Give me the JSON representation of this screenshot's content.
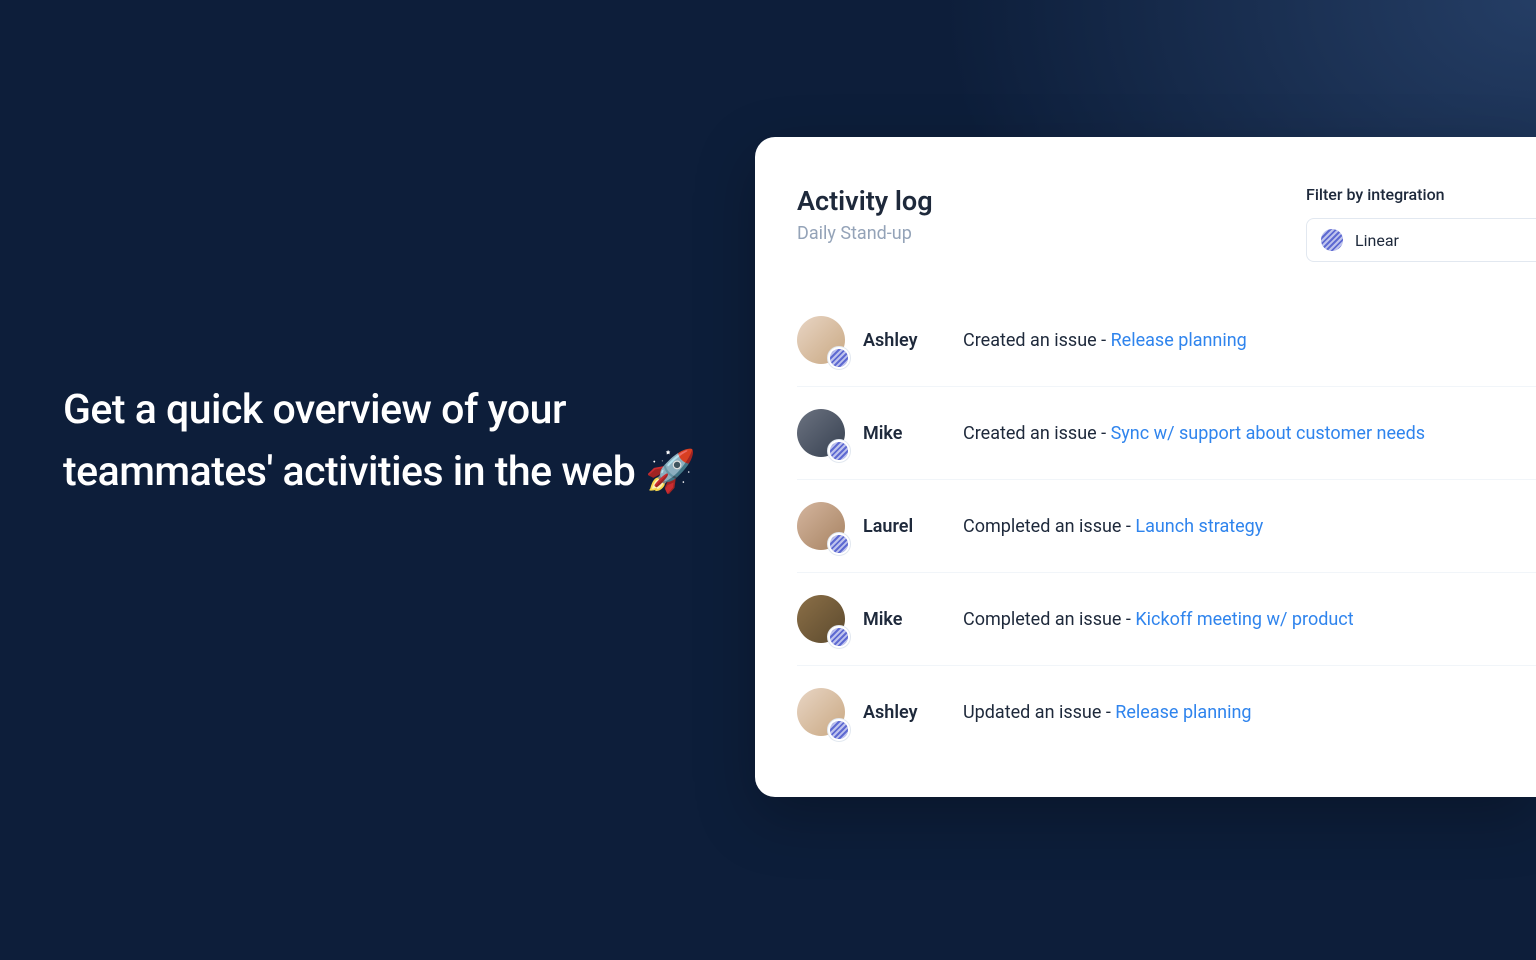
{
  "heading": "Get a quick overview of your teammates' activities in the web 🚀",
  "card": {
    "title": "Activity log",
    "subtitle": "Daily Stand-up"
  },
  "filter": {
    "label": "Filter by integration",
    "selected": "Linear"
  },
  "activities": [
    {
      "user": "Ashley",
      "action": "Created an issue - ",
      "link": "Release planning",
      "avatar": "a"
    },
    {
      "user": "Mike",
      "action": "Created an issue - ",
      "link": "Sync w/ support about customer needs",
      "avatar": "b"
    },
    {
      "user": "Laurel",
      "action": "Completed an issue -  ",
      "link": "Launch strategy",
      "avatar": "c"
    },
    {
      "user": "Mike",
      "action": "Completed an issue - ",
      "link": "Kickoff meeting w/ product",
      "avatar": "d"
    },
    {
      "user": "Ashley",
      "action": "Updated an issue - ",
      "link": "Release planning",
      "avatar": "a"
    }
  ]
}
